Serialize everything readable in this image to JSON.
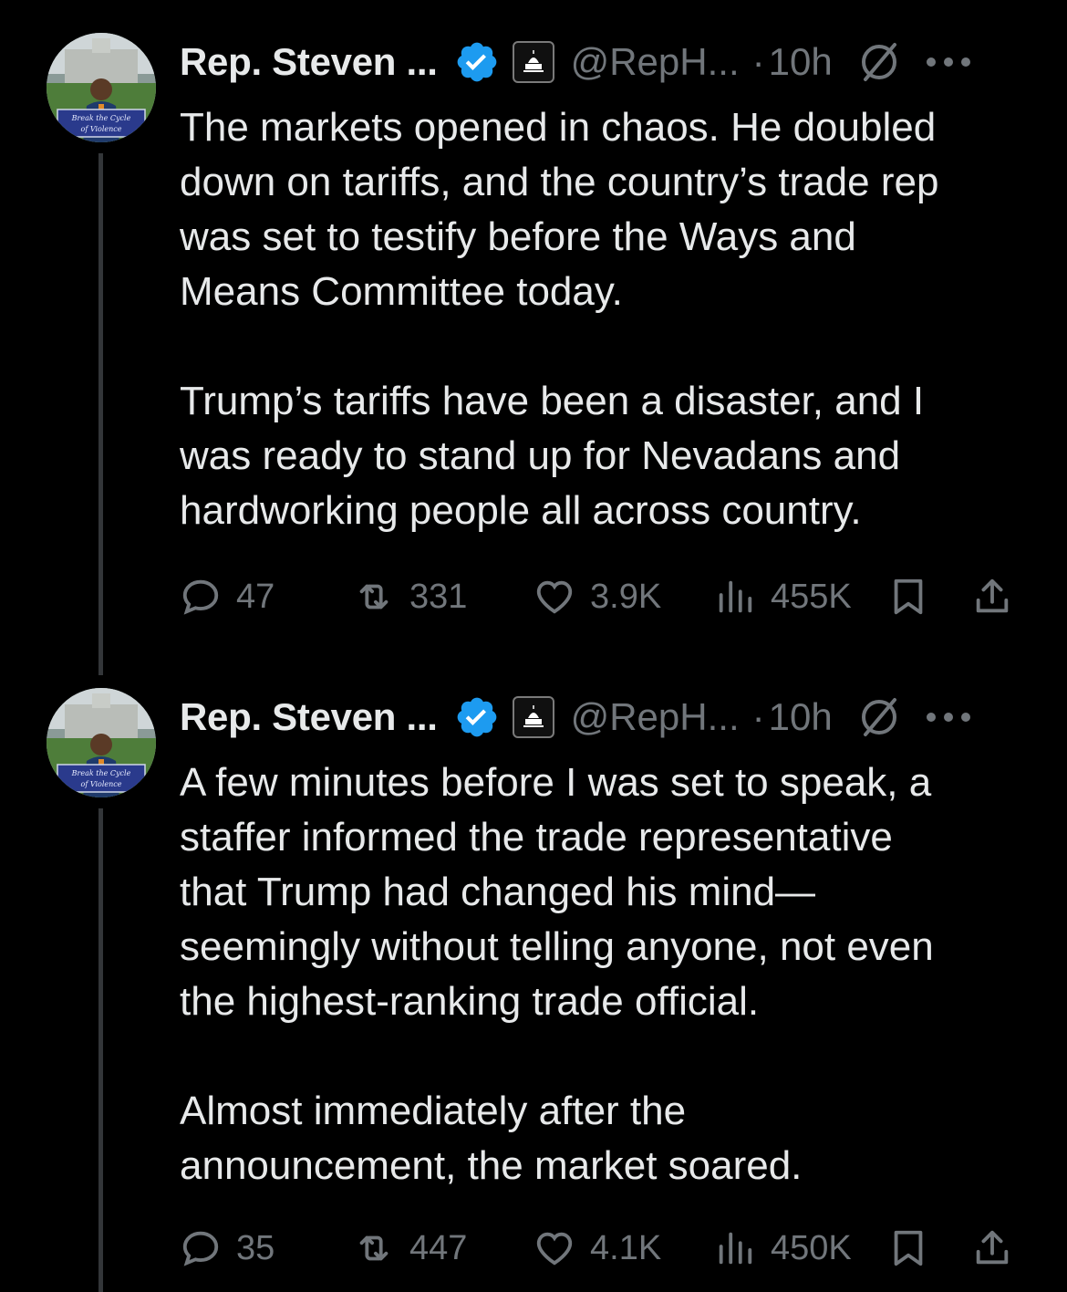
{
  "tweets": [
    {
      "display_name": "Rep. Steven ...",
      "handle": "@RepH...",
      "separator": "·",
      "time": "10h",
      "avatar_sign_text": "Break the Cycle of Violence",
      "text": "The markets opened in chaos. He doubled\ndown on tariffs, and the country’s trade rep\nwas set to testify before the Ways and\nMeans Committee today.\n\nTrump’s tariffs have been a disaster, and I\nwas ready to stand up for Nevadans and\nhardworking people all across country.",
      "stats": {
        "replies": "47",
        "reposts": "331",
        "likes": "3.9K",
        "views": "455K"
      }
    },
    {
      "display_name": "Rep. Steven ...",
      "handle": "@RepH...",
      "separator": "·",
      "time": "10h",
      "avatar_sign_text": "Break the Cycle of Violence",
      "text": "A few minutes before I was set to speak, a\nstaffer informed the trade representative\nthat Trump had changed his mind—\nseemingly without telling anyone, not even\nthe highest-ranking trade official.\n\nAlmost immediately after the\nannouncement, the market soared.",
      "stats": {
        "replies": "35",
        "reposts": "447",
        "likes": "4.1K",
        "views": "450K"
      }
    }
  ],
  "icons": {
    "verified": "verified-badge-icon",
    "affiliation": "capitol-affiliation-icon",
    "grok": "grok-icon",
    "more": "more-options-icon",
    "reply": "reply-icon",
    "retweet": "retweet-icon",
    "like": "like-icon",
    "views": "views-icon",
    "bookmark": "bookmark-icon",
    "share": "share-icon"
  },
  "colors": {
    "background": "#000000",
    "primary_text": "#e7e9ea",
    "secondary_text": "#71767b",
    "verified_blue": "#1d9bf0",
    "thread_line": "#333639"
  }
}
